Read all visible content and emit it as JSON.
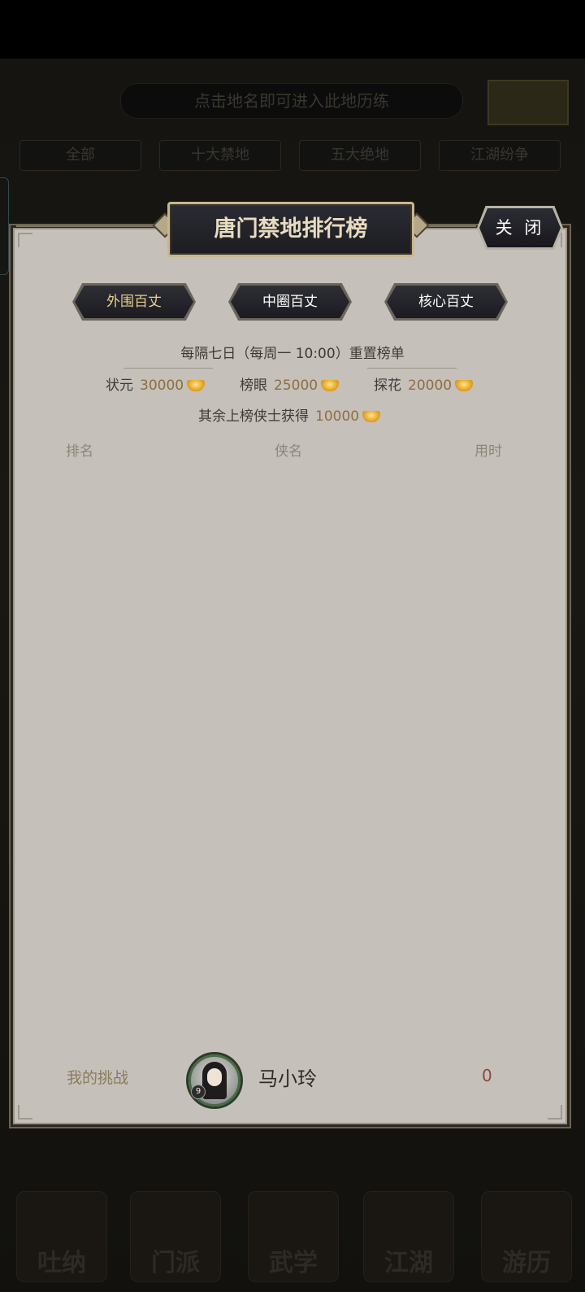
{
  "background": {
    "hint": "点击地名即可进入此地历练",
    "tabs": [
      "全部",
      "十大禁地",
      "五大绝地",
      "江湖纷争"
    ],
    "bottom_nav": [
      "吐纳",
      "门派",
      "武学",
      "江湖",
      "游历"
    ]
  },
  "dialog": {
    "title": "唐门禁地排行榜",
    "close_label": "关 闭",
    "tabs": [
      {
        "label": "外围百丈",
        "active": true
      },
      {
        "label": "中圈百丈",
        "active": false
      },
      {
        "label": "核心百丈",
        "active": false
      }
    ],
    "reset_text": "每隔七日（每周一 10:00）重置榜单",
    "rewards": [
      {
        "title": "状元",
        "amount": "30000",
        "icon": "gold-ingot-icon"
      },
      {
        "title": "榜眼",
        "amount": "25000",
        "icon": "gold-ingot-icon"
      },
      {
        "title": "探花",
        "amount": "20000",
        "icon": "gold-ingot-icon"
      }
    ],
    "others_reward": {
      "label": "其余上榜侠士获得",
      "amount": "10000",
      "icon": "gold-ingot-icon"
    },
    "columns": {
      "rank": "排名",
      "name": "侠名",
      "time": "用时"
    },
    "my_challenge": {
      "label": "我的挑战",
      "name": "马小玲",
      "time": "0",
      "avatar_level": "9"
    }
  },
  "colors": {
    "panel_bg": "#c6c0bb",
    "accent_gold": "#e7cf8a",
    "amount_brown": "#8d6f3d"
  }
}
